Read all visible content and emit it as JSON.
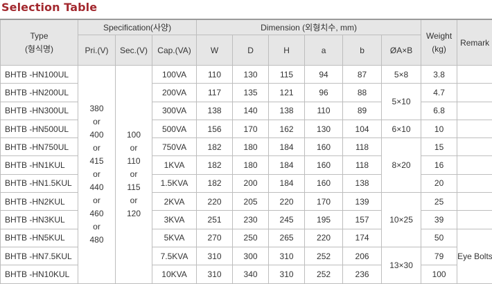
{
  "title": "Selection Table",
  "headers": {
    "type": "Type",
    "type_kr": "(형식명)",
    "specification": "Specification(사양)",
    "dimension": "Dimension (외형치수, mm)",
    "weight": "Weight",
    "weight_unit": "(kg)",
    "remark": "Remark",
    "pri": "Pri.(V)",
    "sec": "Sec.(V)",
    "cap": "Cap.(VA)",
    "w": "W",
    "d": "D",
    "h": "H",
    "a": "a",
    "b": "b",
    "hole": "ØA×B"
  },
  "pri_values": [
    "380",
    "or",
    "400",
    "or",
    "415",
    "or",
    "440",
    "or",
    "460",
    "or",
    "480"
  ],
  "sec_values": [
    "100",
    "or",
    "110",
    "or",
    "115",
    "or",
    "120"
  ],
  "rows": [
    {
      "model": "BHTB -HN100UL",
      "cap": "100VA",
      "w": "110",
      "d": "130",
      "h": "115",
      "a": "94",
      "b": "87",
      "weight": "3.8"
    },
    {
      "model": "BHTB -HN200UL",
      "cap": "200VA",
      "w": "117",
      "d": "135",
      "h": "121",
      "a": "96",
      "b": "88",
      "weight": "4.7"
    },
    {
      "model": "BHTB -HN300UL",
      "cap": "300VA",
      "w": "138",
      "d": "140",
      "h": "138",
      "a": "110",
      "b": "89",
      "weight": "6.8"
    },
    {
      "model": "BHTB -HN500UL",
      "cap": "500VA",
      "w": "156",
      "d": "170",
      "h": "162",
      "a": "130",
      "b": "104",
      "weight": "10"
    },
    {
      "model": "BHTB -HN750UL",
      "cap": "750VA",
      "w": "182",
      "d": "180",
      "h": "184",
      "a": "160",
      "b": "118",
      "weight": "15"
    },
    {
      "model": "BHTB -HN1KUL",
      "cap": "1KVA",
      "w": "182",
      "d": "180",
      "h": "184",
      "a": "160",
      "b": "118",
      "weight": "16"
    },
    {
      "model": "BHTB -HN1.5KUL",
      "cap": "1.5KVA",
      "w": "182",
      "d": "200",
      "h": "184",
      "a": "160",
      "b": "138",
      "weight": "20"
    },
    {
      "model": "BHTB -HN2KUL",
      "cap": "2KVA",
      "w": "220",
      "d": "205",
      "h": "220",
      "a": "170",
      "b": "139",
      "weight": "25"
    },
    {
      "model": "BHTB -HN3KUL",
      "cap": "3KVA",
      "w": "251",
      "d": "230",
      "h": "245",
      "a": "195",
      "b": "157",
      "weight": "39"
    },
    {
      "model": "BHTB -HN5KUL",
      "cap": "5KVA",
      "w": "270",
      "d": "250",
      "h": "265",
      "a": "220",
      "b": "174",
      "weight": "50"
    },
    {
      "model": "BHTB -HN7.5KUL",
      "cap": "7.5KVA",
      "w": "310",
      "d": "300",
      "h": "310",
      "a": "252",
      "b": "206",
      "weight": "79"
    },
    {
      "model": "BHTB -HN10KUL",
      "cap": "10KVA",
      "w": "310",
      "d": "340",
      "h": "310",
      "a": "252",
      "b": "236",
      "weight": "100"
    }
  ],
  "holes": [
    "5×8",
    "5×10",
    "6×10",
    "8×20",
    "10×25",
    "13×30"
  ],
  "remark_text": "Eye Bolts"
}
